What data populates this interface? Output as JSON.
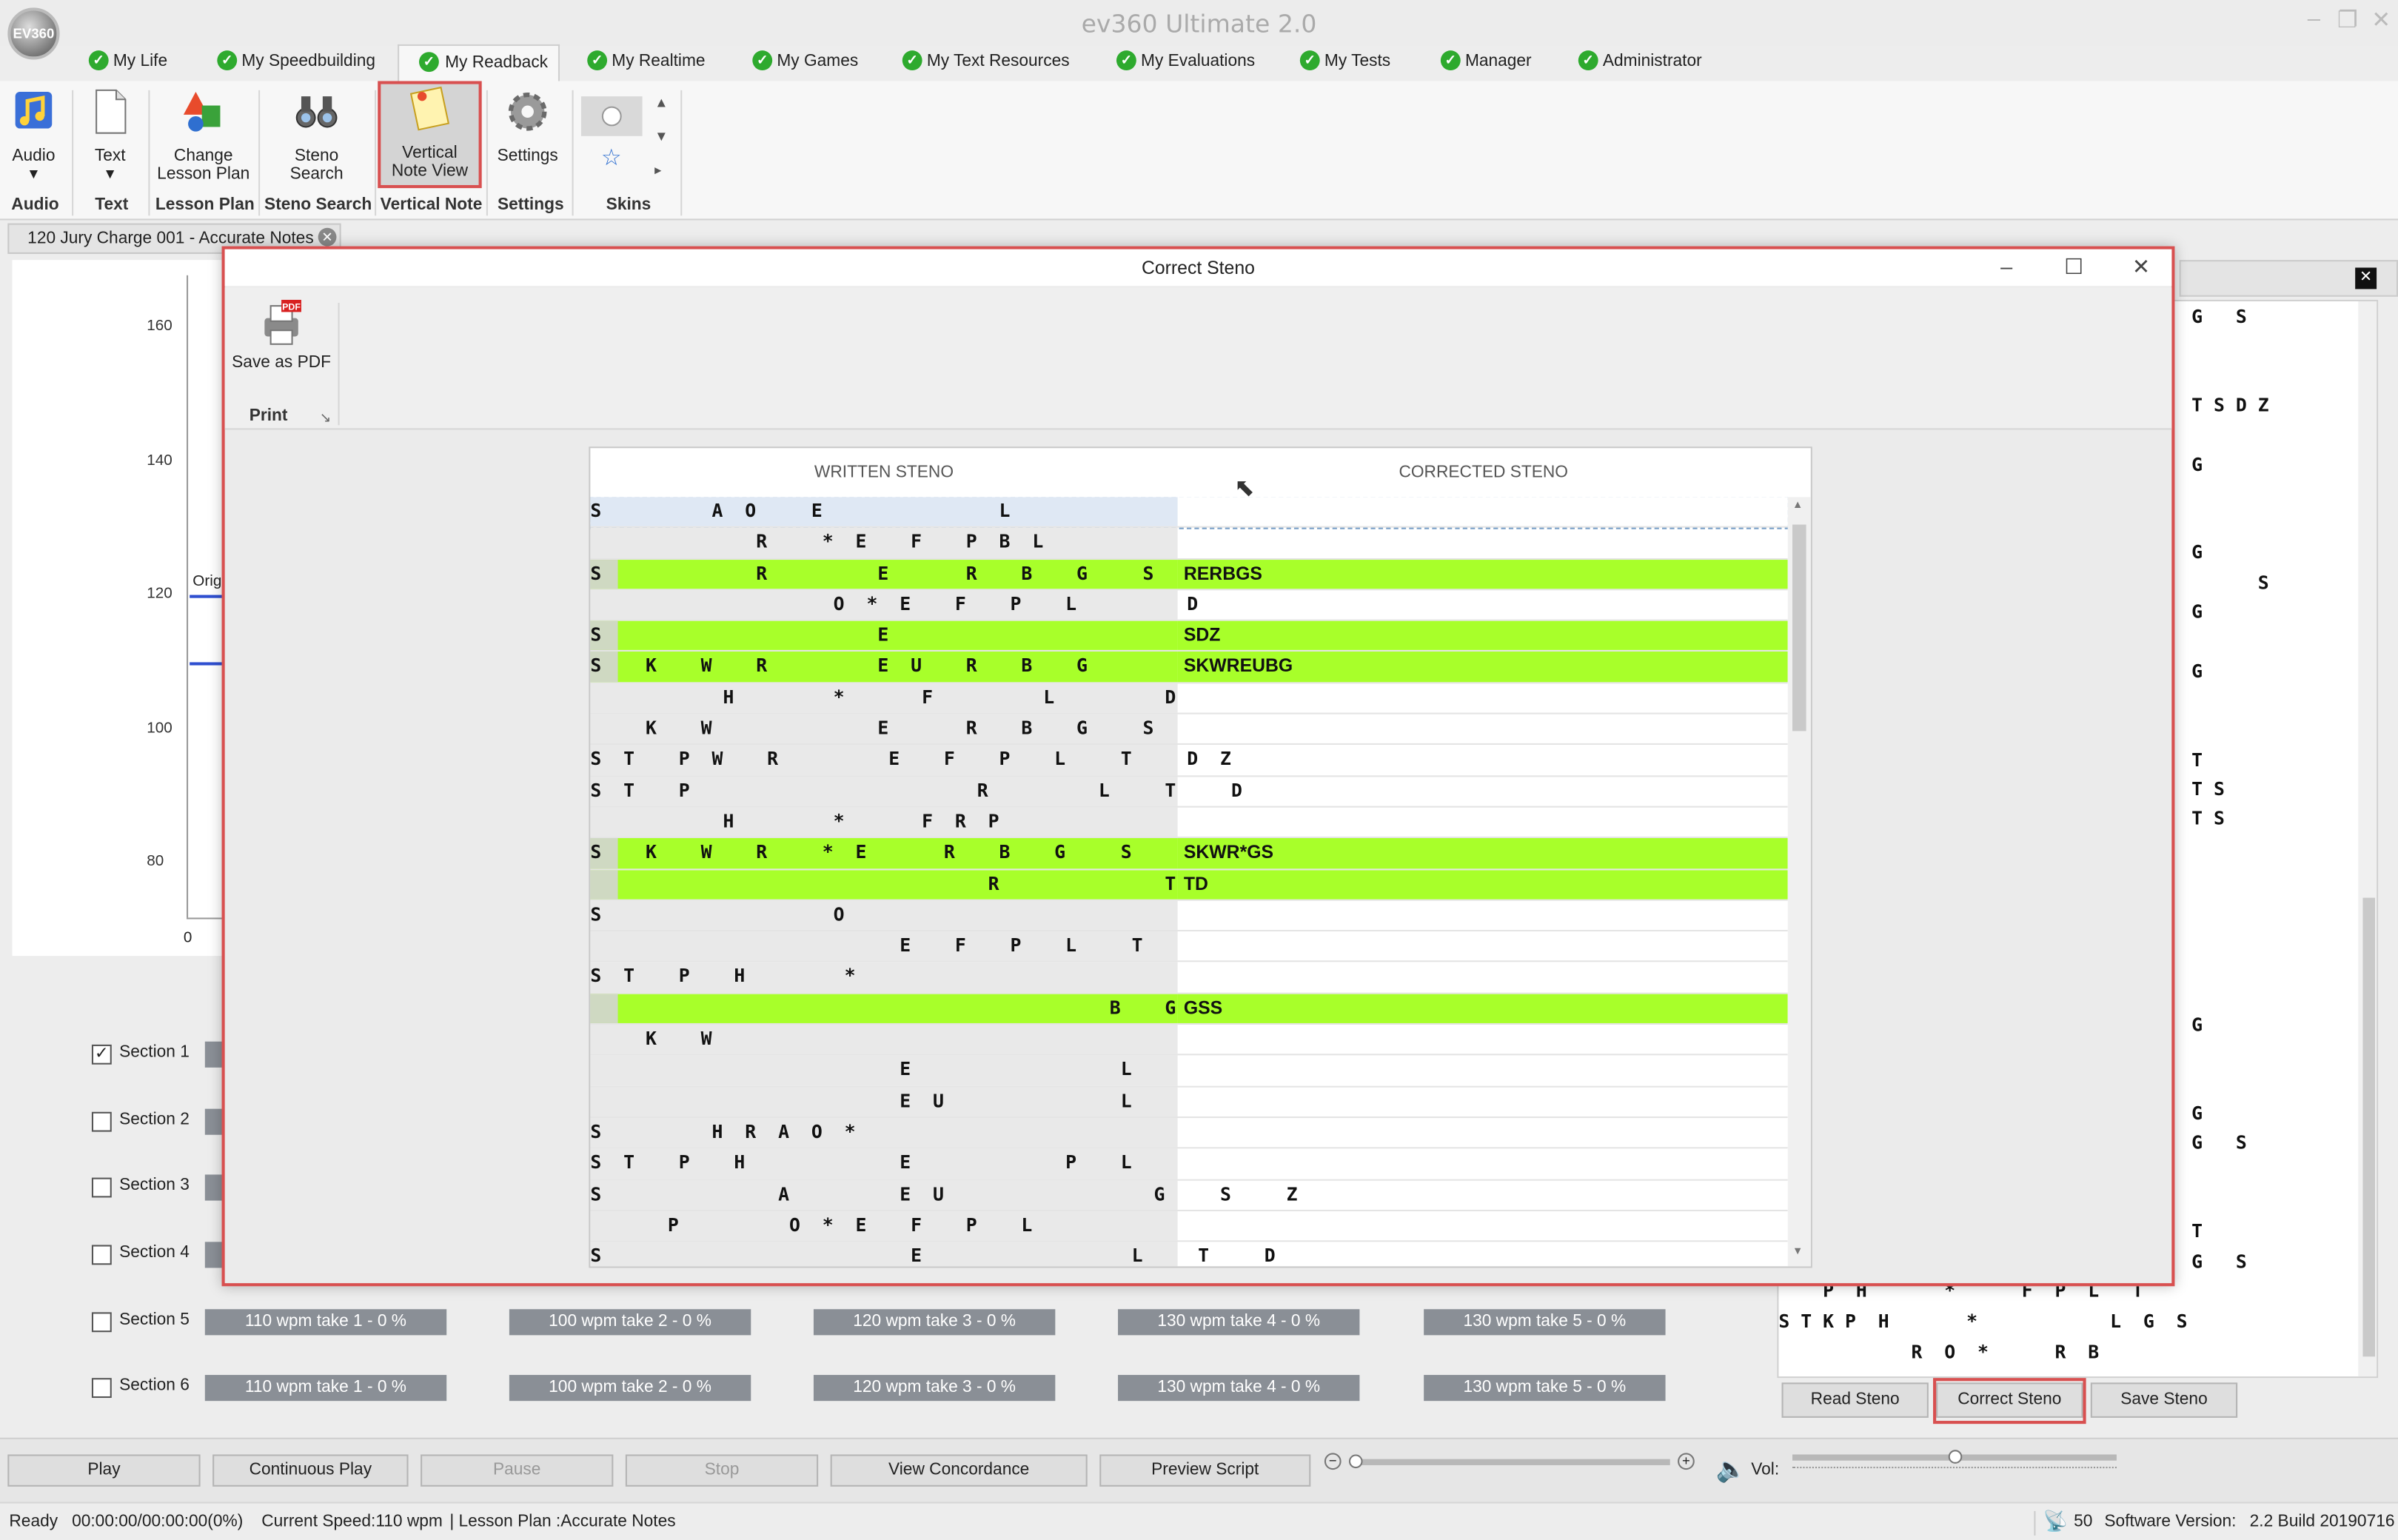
{
  "app": {
    "title": "ev360 Ultimate 2.0",
    "logo_text": "EV360"
  },
  "menu_tabs": [
    {
      "label": "My Life"
    },
    {
      "label": "My Speedbuilding"
    },
    {
      "label": "My Readback"
    },
    {
      "label": "My Realtime"
    },
    {
      "label": "My Games"
    },
    {
      "label": "My Text Resources"
    },
    {
      "label": "My Evaluations"
    },
    {
      "label": "My Tests"
    },
    {
      "label": "Manager"
    },
    {
      "label": "Administrator"
    }
  ],
  "ribbon": {
    "audio": "Audio",
    "text": "Text",
    "change_lesson_1": "Change",
    "change_lesson_2": "Lesson Plan",
    "steno_search_1": "Steno",
    "steno_search_2": "Search",
    "vertical_1": "Vertical",
    "vertical_2": "Note View",
    "settings": "Settings",
    "groups": {
      "audio": "Audio",
      "text": "Text",
      "lesson_plan": "Lesson Plan",
      "steno_search": "Steno Search",
      "vertical_note": "Vertical Note",
      "settings": "Settings",
      "skins": "Skins"
    }
  },
  "document_tab": "120 Jury Charge 001 - Accurate Notes",
  "chart": {
    "y_ticks": [
      "160",
      "140",
      "120",
      "100",
      "80"
    ],
    "x_tick": "0",
    "legend_fragment": "Origi"
  },
  "sections": [
    {
      "label": "Section 1",
      "checked": true
    },
    {
      "label": "Section 2",
      "checked": false
    },
    {
      "label": "Section 3",
      "checked": false
    },
    {
      "label": "Section 4",
      "checked": false
    },
    {
      "label": "Section 5",
      "checked": false,
      "takes": [
        "110 wpm take 1 - 0 %",
        "100 wpm take 2 - 0 %",
        "120 wpm take 3 - 0 %",
        "130 wpm take 4 - 0 %",
        "130 wpm take 5 - 0 %"
      ]
    },
    {
      "label": "Section 6",
      "checked": false,
      "takes": [
        "110 wpm take 1 - 0 %",
        "100 wpm take 2 - 0 %",
        "120 wpm take 3 - 0 %",
        "130 wpm take 4 - 0 %",
        "130 wpm take 5 - 0 %"
      ]
    }
  ],
  "right_panel": {
    "lines": [
      "G   S",
      "",
      "",
      "T S D Z",
      "",
      "G",
      "",
      "",
      "G",
      "      S",
      "G",
      "",
      "G",
      "",
      "",
      "T",
      "T S",
      "T S",
      "",
      "",
      "",
      "",
      "",
      "",
      "G",
      "",
      "",
      "G",
      "G   S",
      "",
      "",
      "T",
      "G   S",
      "",
      "",
      "",
      "",
      "",
      "",
      "",
      "",
      ""
    ],
    "bottom_lines": [
      "    P  H       *      F  P  L   T",
      "S T K P  H       *            L  G  S",
      "            R  O  *      R  B"
    ],
    "buttons": {
      "read": "Read Steno",
      "correct": "Correct Steno",
      "save": "Save Steno"
    }
  },
  "player": {
    "play": "Play",
    "continuous": "Continuous Play",
    "pause": "Pause",
    "stop": "Stop",
    "concordance": "View Concordance",
    "preview": "Preview  Script",
    "vol_label": "Vol:"
  },
  "status": {
    "ready": "Ready",
    "time": "00:00:00/00:00:00(0%)",
    "speed": "Current Speed:110 wpm",
    "lesson": "| Lesson Plan :Accurate Notes",
    "count": "50",
    "version_label": "Software Version:",
    "version": "2.2 Build 20190716"
  },
  "dialog": {
    "title": "Correct Steno",
    "save_pdf": "Save as PDF",
    "print_group": "Print",
    "col_written": "WRITTEN STENO",
    "col_corrected": "CORRECTED STENO",
    "rows": [
      {
        "w": "S          A  O     E                L",
        "c": "",
        "hl": false,
        "sel": true
      },
      {
        "w": "               R     *  E    F    P  B  L",
        "c": "",
        "hl": false
      },
      {
        "w": "S              R          E       R    B    G     S",
        "c": "RERBGS",
        "hl": true
      },
      {
        "w": "                      O  *  E    F    P    L          D",
        "c": "",
        "hl": false
      },
      {
        "w": "S                         E                               D  Z",
        "c": "SDZ",
        "hl": true
      },
      {
        "w": "S    K    W    R          E  U    R    B    G",
        "c": "SKWREUBG",
        "hl": true
      },
      {
        "w": "            H         *       F          L          D",
        "c": "",
        "hl": false
      },
      {
        "w": "     K    W               E       R    B    G     S",
        "c": "",
        "hl": false
      },
      {
        "w": "S  T    P  W    R          E    F    P    L     T     D  Z",
        "c": "",
        "hl": false
      },
      {
        "w": "S  T    P                          R          L     T     D",
        "c": "",
        "hl": false
      },
      {
        "w": "            H         *       F  R  P",
        "c": "",
        "hl": false
      },
      {
        "w": "S    K    W    R     *  E       R    B    G     S",
        "c": "SKWR*GS",
        "hl": true
      },
      {
        "w": "                                    R               T     D",
        "c": "TD",
        "hl": true
      },
      {
        "w": "S                     O",
        "c": "",
        "hl": false
      },
      {
        "w": "                            E    F    P    L     T",
        "c": "",
        "hl": false
      },
      {
        "w": "S  T    P    H         *",
        "c": "",
        "hl": false
      },
      {
        "w": "                                               B    G",
        "c": "GSS",
        "hl": true
      },
      {
        "w": "     K    W",
        "c": "",
        "hl": false
      },
      {
        "w": "                            E                   L",
        "c": "",
        "hl": false
      },
      {
        "w": "                            E  U                L",
        "c": "",
        "hl": false
      },
      {
        "w": "S          H  R  A  O  *",
        "c": "",
        "hl": false
      },
      {
        "w": "S  T    P    H              E              P    L",
        "c": "",
        "hl": false
      },
      {
        "w": "S                A          E  U                   G     S     Z",
        "c": "",
        "hl": false
      },
      {
        "w": "       P          O  *  E    F    P    L",
        "c": "",
        "hl": false
      },
      {
        "w": "S                            E                   L     T     D",
        "c": "",
        "hl": false
      }
    ]
  }
}
